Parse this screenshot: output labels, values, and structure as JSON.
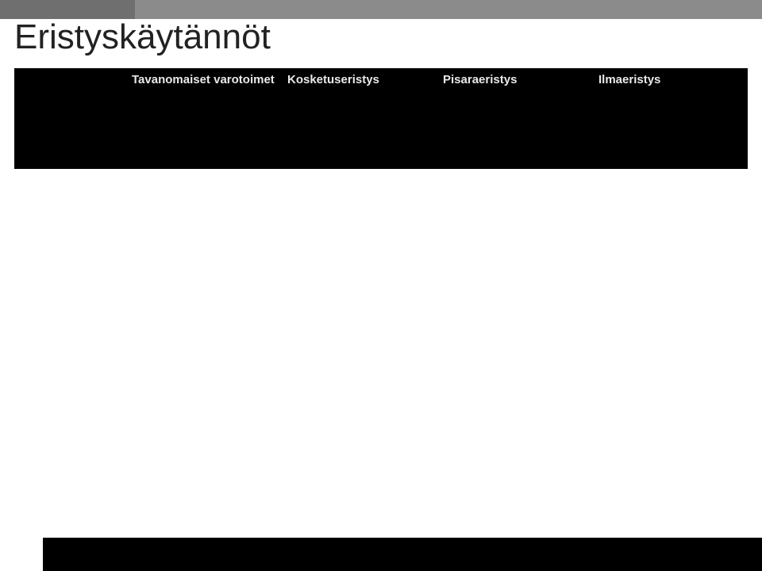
{
  "title": "Eristyskäytännöt",
  "table": {
    "headers": {
      "c0": "",
      "c1": "Tavanomaiset varotoimet",
      "c2": "Kosketuseristys",
      "c3": "Pisaraeristys",
      "c4": "Ilmaeristys"
    },
    "row_labels": [
      "",
      "",
      "",
      "",
      "",
      "",
      "",
      ""
    ]
  }
}
